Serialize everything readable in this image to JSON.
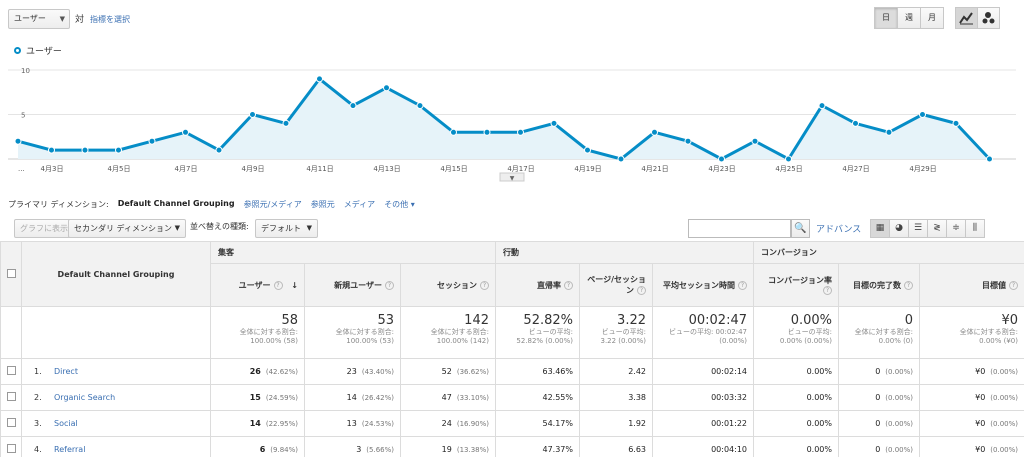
{
  "toolbar": {
    "metric_select": "ユーザー",
    "vs_label": "対",
    "pick_metric": "指標を選択",
    "period_buttons": [
      "日",
      "週",
      "月"
    ],
    "active_period": "日"
  },
  "legend": {
    "label": "ユーザー",
    "color": "#058dc7"
  },
  "chart_data": {
    "type": "area",
    "series": [
      {
        "name": "ユーザー",
        "values": [
          2,
          1,
          1,
          1,
          2,
          3,
          1,
          5,
          4,
          9,
          6,
          8,
          6,
          3,
          3,
          3,
          4,
          1,
          0,
          3,
          2,
          0,
          2,
          0,
          6,
          4,
          3,
          5,
          4,
          0
        ]
      }
    ],
    "x_tick_labels": [
      "...",
      "4月3日",
      "4月5日",
      "4月7日",
      "4月9日",
      "4月11日",
      "4月13日",
      "4月15日",
      "4月17日",
      "4月19日",
      "4月21日",
      "4月23日",
      "4月25日",
      "4月27日",
      "4月29日"
    ],
    "y_ticks": [
      "10",
      "5"
    ],
    "ylim": [
      0,
      10
    ],
    "grid": true,
    "color": "#058dc7"
  },
  "dimension_row": {
    "label": "プライマリ ディメンション:",
    "selected": "Default Channel Grouping",
    "links": [
      "参照元/メディア",
      "参照元",
      "メディア",
      "その他 ▾"
    ]
  },
  "toolbar2": {
    "graph_button": "グラフに表示",
    "secondary_dimension": "セカンダリ ディメンション",
    "sort_label": "並べ替えの種類:",
    "sort_value": "デフォルト",
    "advance": "アドバンス"
  },
  "table": {
    "dimension_header": "Default Channel Grouping",
    "groups": [
      "集客",
      "行動",
      "コンバージョン"
    ],
    "columns": [
      "ユーザー",
      "新規ユーザー",
      "セッション",
      "直帰率",
      "ページ/セッション",
      "平均セッション時間",
      "コンバージョン率",
      "目標の完了数",
      "目標値"
    ],
    "totals": [
      {
        "big": "58",
        "l1": "全体に対する割合:",
        "l2": "100.00% (58)"
      },
      {
        "big": "53",
        "l1": "全体に対する割合:",
        "l2": "100.00% (53)"
      },
      {
        "big": "142",
        "l1": "全体に対する割合:",
        "l2": "100.00% (142)"
      },
      {
        "big": "52.82%",
        "l1": "ビューの平均:",
        "l2": "52.82% (0.00%)"
      },
      {
        "big": "3.22",
        "l1": "ビューの平均:",
        "l2": "3.22 (0.00%)"
      },
      {
        "big": "00:02:47",
        "l1": "ビューの平均: 00:02:47",
        "l2": "(0.00%)"
      },
      {
        "big": "0.00%",
        "l1": "ビューの平均:",
        "l2": "0.00% (0.00%)"
      },
      {
        "big": "0",
        "l1": "全体に対する割合:",
        "l2": "0.00% (0)"
      },
      {
        "big": "¥0",
        "l1": "全体に対する割合:",
        "l2": "0.00% (¥0)"
      }
    ],
    "rows": [
      {
        "idx": "1.",
        "name": "Direct",
        "users": "26",
        "users_pct": "(42.62%)",
        "new_users": "23",
        "new_users_pct": "(43.40%)",
        "sessions": "52",
        "sessions_pct": "(36.62%)",
        "bounce": "63.46%",
        "pps": "2.42",
        "duration": "00:02:14",
        "conv": "0.00%",
        "goals": "0",
        "goals_pct": "(0.00%)",
        "value": "¥0",
        "value_pct": "(0.00%)"
      },
      {
        "idx": "2.",
        "name": "Organic Search",
        "users": "15",
        "users_pct": "(24.59%)",
        "new_users": "14",
        "new_users_pct": "(26.42%)",
        "sessions": "47",
        "sessions_pct": "(33.10%)",
        "bounce": "42.55%",
        "pps": "3.38",
        "duration": "00:03:32",
        "conv": "0.00%",
        "goals": "0",
        "goals_pct": "(0.00%)",
        "value": "¥0",
        "value_pct": "(0.00%)"
      },
      {
        "idx": "3.",
        "name": "Social",
        "users": "14",
        "users_pct": "(22.95%)",
        "new_users": "13",
        "new_users_pct": "(24.53%)",
        "sessions": "24",
        "sessions_pct": "(16.90%)",
        "bounce": "54.17%",
        "pps": "1.92",
        "duration": "00:01:22",
        "conv": "0.00%",
        "goals": "0",
        "goals_pct": "(0.00%)",
        "value": "¥0",
        "value_pct": "(0.00%)"
      },
      {
        "idx": "4.",
        "name": "Referral",
        "users": "6",
        "users_pct": "(9.84%)",
        "new_users": "3",
        "new_users_pct": "(5.66%)",
        "sessions": "19",
        "sessions_pct": "(13.38%)",
        "bounce": "47.37%",
        "pps": "6.63",
        "duration": "00:04:10",
        "conv": "0.00%",
        "goals": "0",
        "goals_pct": "(0.00%)",
        "value": "¥0",
        "value_pct": "(0.00%)"
      }
    ]
  }
}
